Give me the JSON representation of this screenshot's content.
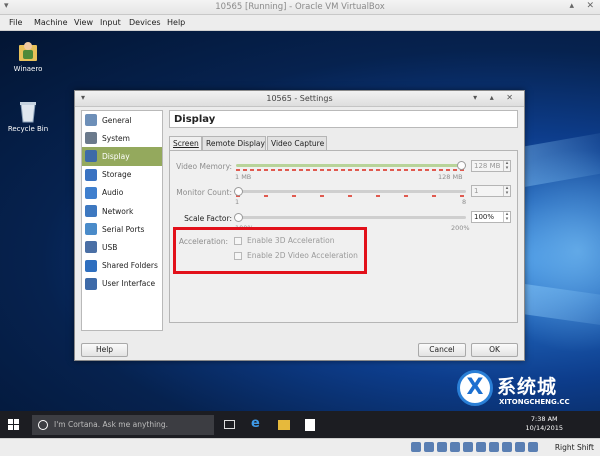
{
  "host_window": {
    "title": "10565 [Running] - Oracle VM VirtualBox",
    "menu": [
      "File",
      "Machine",
      "View",
      "Input",
      "Devices",
      "Help"
    ],
    "host_key": "Right Shift"
  },
  "desktop": {
    "icons": [
      {
        "label": "Winaero",
        "icon": "user-folder-icon"
      },
      {
        "label": "Recycle Bin",
        "icon": "recycle-bin-icon"
      }
    ]
  },
  "dialog": {
    "title": "10565 - Settings",
    "sidebar": [
      {
        "label": "General",
        "icon": "general-icon",
        "color": "#6d8fb8"
      },
      {
        "label": "System",
        "icon": "system-icon",
        "color": "#6b7a8c"
      },
      {
        "label": "Display",
        "icon": "display-icon",
        "color": "#3d6aa8",
        "selected": true
      },
      {
        "label": "Storage",
        "icon": "storage-icon",
        "color": "#3a73c2"
      },
      {
        "label": "Audio",
        "icon": "audio-icon",
        "color": "#3f7fce"
      },
      {
        "label": "Network",
        "icon": "network-icon",
        "color": "#3d78c0"
      },
      {
        "label": "Serial Ports",
        "icon": "serial-port-icon",
        "color": "#4a8bc9"
      },
      {
        "label": "USB",
        "icon": "usb-icon",
        "color": "#4a6fa5"
      },
      {
        "label": "Shared Folders",
        "icon": "folder-icon",
        "color": "#2f6fbf"
      },
      {
        "label": "User Interface",
        "icon": "ui-icon",
        "color": "#3d6aa8"
      }
    ],
    "panel_title": "Display",
    "tabs": [
      "Screen",
      "Remote Display",
      "Video Capture"
    ],
    "screen": {
      "video_memory": {
        "label": "Video Memory:",
        "value": "128 MB",
        "min": "1 MB",
        "max": "128 MB",
        "fraction": 1.0
      },
      "monitor_count": {
        "label": "Monitor Count:",
        "value": "1",
        "min": "1",
        "max": "8",
        "fraction": 0.0
      },
      "scale_factor": {
        "label": "Scale Factor:",
        "value": "100%",
        "min": "100%",
        "max": "200%",
        "fraction": 0.0
      },
      "acceleration": {
        "label": "Acceleration:",
        "options": [
          "Enable 3D Acceleration",
          "Enable 2D Video Acceleration"
        ]
      }
    },
    "buttons": {
      "help": "Help",
      "cancel": "Cancel",
      "ok": "OK"
    },
    "highlight_color": "#e2101a"
  },
  "taskbar": {
    "cortana_placeholder": "I'm Cortana. Ask me anything.",
    "time": "7:38 AM",
    "date": "10/14/2015",
    "watermark_main": "系统城",
    "watermark_sub": "XITONGCHENG.CC",
    "watermark_logo": "X"
  }
}
